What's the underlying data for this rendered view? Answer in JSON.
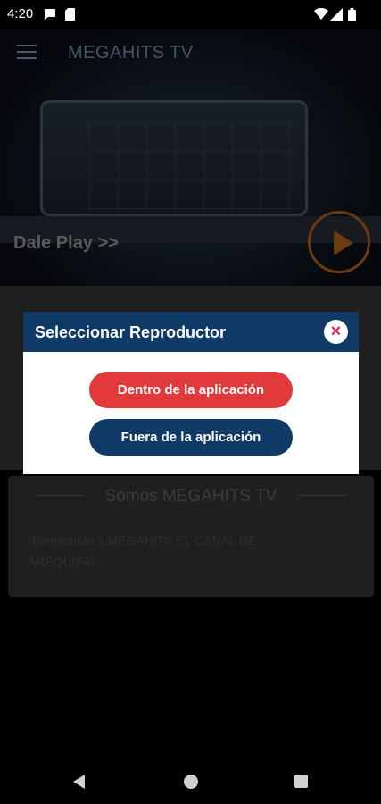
{
  "status_bar": {
    "time": "4:20",
    "icons": [
      "chat-icon",
      "sim-icon",
      "wifi-icon",
      "signal-icon",
      "battery-icon"
    ]
  },
  "app_bar": {
    "menu_icon": "hamburger-menu-icon",
    "title": "MEGAHITS TV"
  },
  "hero": {
    "label": "Dale Play >>",
    "play_icon": "play-icon",
    "accent_color": "#6b3a12"
  },
  "about_card": {
    "title": "Somos MEGAHITS TV",
    "text": "¡Bienvenido a MEGAHITS EL CANAL DE AREQUIPA!"
  },
  "dialog": {
    "title": "Seleccionar Reproductor",
    "close_icon": "close-icon",
    "header_color": "#0f3a66",
    "buttons": {
      "inside": "Dentro de la aplicación",
      "outside": "Fuera de la aplicación"
    },
    "inside_color": "#e23a3a",
    "outside_color": "#0f3a66"
  },
  "nav_bar": {
    "icons": [
      "back-icon",
      "home-icon",
      "recent-apps-icon"
    ]
  }
}
